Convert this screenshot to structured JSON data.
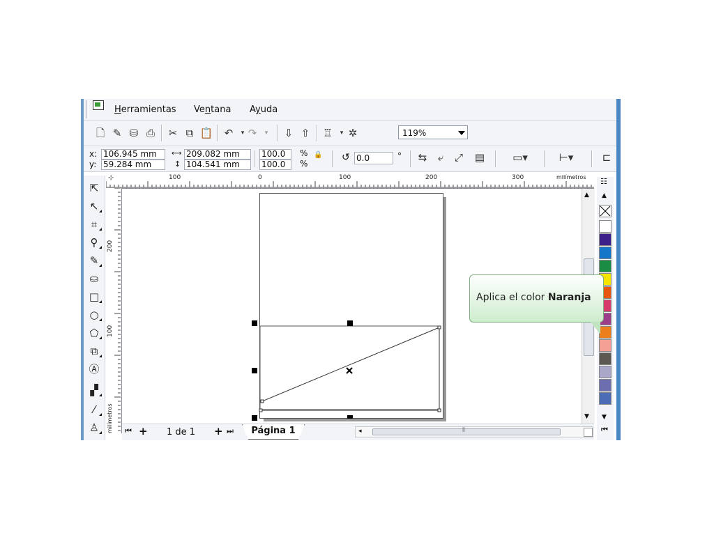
{
  "menu": [
    {
      "label": "Herramientas",
      "underline": "H",
      "rest": "erramientas"
    },
    {
      "label": "Ventana",
      "pre": "Ve",
      "underline": "n",
      "rest": "tana"
    },
    {
      "label": "Ayuda",
      "pre": "A",
      "underline": "y",
      "rest": "uda"
    }
  ],
  "toolbar": {
    "zoom_value": "119%"
  },
  "properties": {
    "x_label": "x:",
    "x_value": "106.945 mm",
    "y_label": "y:",
    "y_value": "59.284 mm",
    "width_value": "209.082 mm",
    "height_value": "104.541 mm",
    "scale_x": "100.0",
    "scale_y": "100.0",
    "percent": "%",
    "rotation_value": "0.0",
    "degree_symbol": "°"
  },
  "ruler": {
    "h_labels": [
      "100",
      "0",
      "100",
      "200",
      "300"
    ],
    "h_unit": "milímetros",
    "v_labels": [
      "200",
      "100"
    ],
    "v_unit": "milímetros"
  },
  "page_nav": {
    "page_count": "1 de 1",
    "page_tab": "Página 1"
  },
  "palette": {
    "colors": [
      "#ffffff",
      "#3d1f8a",
      "#1476c8",
      "#1a8c44",
      "#f5e400",
      "#e8550f",
      "#d63b6c",
      "#9c3e8a",
      "#ec7f1c",
      "#f4a095",
      "#5c5852",
      "#a9a8c8",
      "#6d6eb0",
      "#4d6cb6"
    ]
  },
  "tooltip": {
    "text_prefix": "Aplica el color ",
    "text_bold": "Naranja"
  },
  "colors": {
    "accent_blue": "#4a87c2",
    "tooltip_green": "#cdeccd"
  }
}
